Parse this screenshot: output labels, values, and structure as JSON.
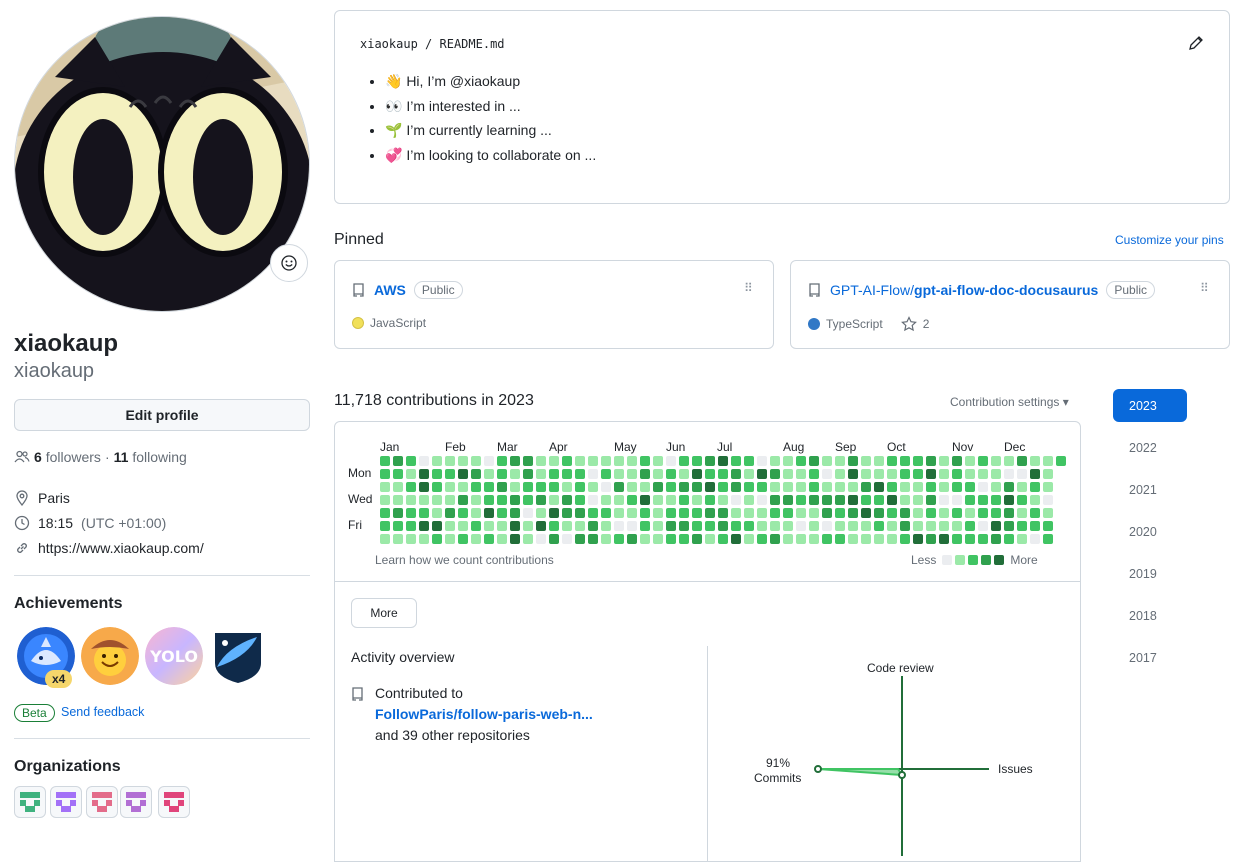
{
  "profile": {
    "fullname": "xiaokaup",
    "username": "xiaokaup",
    "edit_label": "Edit profile",
    "followers_count": "6",
    "followers_label": "followers",
    "separator": "·",
    "following_count": "11",
    "following_label": "following",
    "location": "Paris",
    "time": "18:15",
    "timezone": "(UTC +01:00)",
    "website": "https://www.xiaokaup.com/"
  },
  "achievements": {
    "title": "Achievements",
    "badge_count": "x4",
    "beta_label": "Beta",
    "feedback_label": "Send feedback",
    "items": [
      "shark-achievement",
      "cowboy-achievement",
      "yolo-achievement",
      "starstruck-achievement"
    ]
  },
  "organizations": {
    "title": "Organizations",
    "colors": [
      "#3fb27f",
      "#a371f7",
      "#e36c8a",
      "#b26fd4",
      "#e0457b"
    ]
  },
  "readme": {
    "owner": "xiaokaup",
    "slash": "/",
    "file": "README.md",
    "items": [
      "👋 Hi, I’m @xiaokaup",
      "👀 I’m interested in ...",
      "🌱 I’m currently learning ...",
      "💞️ I’m looking to collaborate on ..."
    ]
  },
  "pinned": {
    "title": "Pinned",
    "customize": "Customize your pins",
    "repos": [
      {
        "owner": "",
        "name": "AWS",
        "visibility": "Public",
        "language": "JavaScript",
        "lang_color": "#f1e05a",
        "stars": ""
      },
      {
        "owner": "GPT-AI-Flow/",
        "name": "gpt-ai-flow-doc-docusaurus",
        "visibility": "Public",
        "language": "TypeScript",
        "lang_color": "#3178c6",
        "stars": "2"
      }
    ]
  },
  "contributions": {
    "title": "11,718 contributions in 2023",
    "settings": "Contribution settings",
    "months": [
      "Jan",
      "Feb",
      "Mar",
      "Apr",
      "May",
      "Jun",
      "Jul",
      "Aug",
      "Sep",
      "Oct",
      "Nov",
      "Dec"
    ],
    "days": [
      "Mon",
      "Wed",
      "Fri"
    ],
    "learn": "Learn how we count contributions",
    "less": "Less",
    "more": "More",
    "level_colors": [
      "#ebedf0",
      "#9be9a8",
      "#40c463",
      "#30a14e",
      "#216e39"
    ]
  },
  "activity": {
    "more_button": "More",
    "title": "Activity overview",
    "contributed_to": "Contributed to",
    "repo_link": "FollowParis/follow-paris-web-n...",
    "others": "and 39 other repositories",
    "axes": {
      "top": "Code review",
      "left_pct": "91%",
      "left": "Commits",
      "right": "Issues"
    },
    "commits_pct": 91
  },
  "years": [
    "2023",
    "2022",
    "2021",
    "2020",
    "2019",
    "2018",
    "2017"
  ]
}
